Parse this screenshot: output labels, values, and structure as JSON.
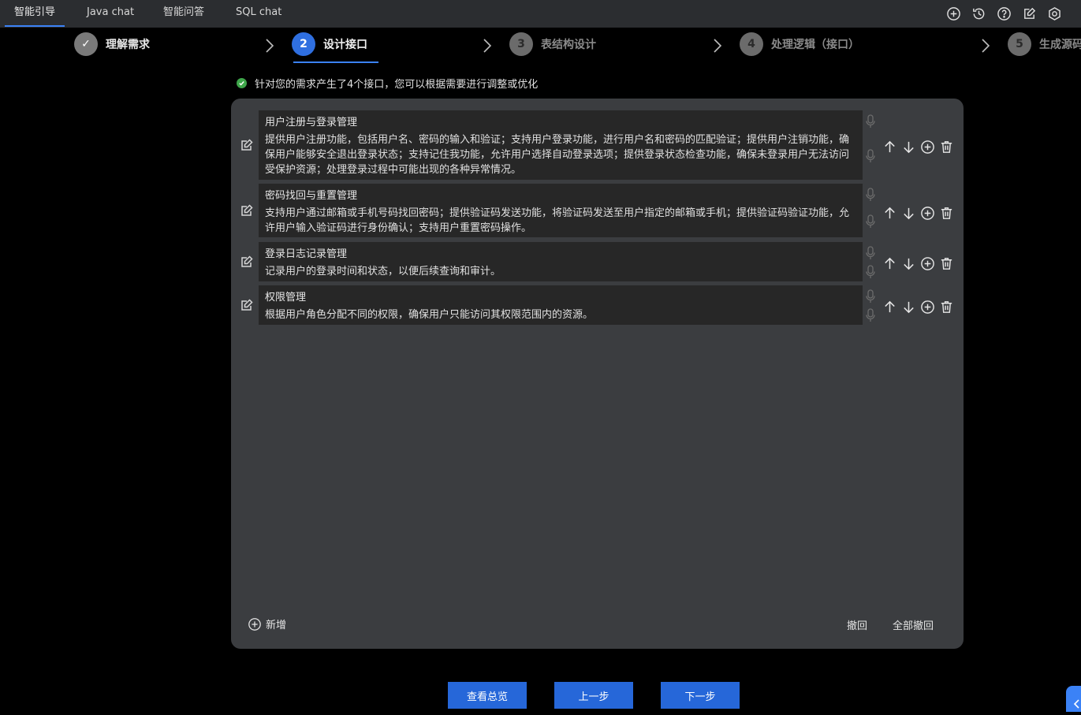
{
  "tabs": [
    "智能引导",
    "Java chat",
    "智能问答",
    "SQL chat"
  ],
  "top_icons": [
    "add-circle-icon",
    "history-icon",
    "help-icon",
    "edit-note-icon",
    "settings-icon"
  ],
  "steps": [
    {
      "num": "✓",
      "label": "理解需求",
      "state": "done"
    },
    {
      "num": "2",
      "label": "设计接口",
      "state": "current"
    },
    {
      "num": "3",
      "label": "表结构设计",
      "state": "pending"
    },
    {
      "num": "4",
      "label": "处理逻辑（接口）",
      "state": "pending"
    },
    {
      "num": "5",
      "label": "生成源码",
      "state": "pending"
    }
  ],
  "notice": "针对您的需求产生了4个接口，您可以根据需要进行调整或优化",
  "interfaces": [
    {
      "title": "用户注册与登录管理",
      "desc": "提供用户注册功能，包括用户名、密码的输入和验证；支持用户登录功能，进行用户名和密码的匹配验证；提供用户注销功能，确保用户能够安全退出登录状态；支持记住我功能，允许用户选择自动登录选项；提供登录状态检查功能，确保未登录用户无法访问受保护资源；处理登录过程中可能出现的各种异常情况。"
    },
    {
      "title": "密码找回与重置管理",
      "desc": "支持用户通过邮箱或手机号码找回密码；提供验证码发送功能，将验证码发送至用户指定的邮箱或手机；提供验证码验证功能，允许用户输入验证码进行身份确认；支持用户重置密码操作。"
    },
    {
      "title": "登录日志记录管理",
      "desc": "记录用户的登录时间和状态，以便后续查询和审计。"
    },
    {
      "title": "权限管理",
      "desc": "根据用户角色分配不同的权限，确保用户只能访问其权限范围内的资源。"
    }
  ],
  "panel": {
    "add_label": "新增",
    "undo_label": "撤回",
    "undo_all_label": "全部撤回"
  },
  "buttons": {
    "overview": "查看总览",
    "prev": "上一步",
    "next": "下一步"
  },
  "colors": {
    "accent": "#2667d9",
    "panel_bg": "#3b3d40",
    "card_bg": "#272727",
    "success": "#3ea64a"
  }
}
